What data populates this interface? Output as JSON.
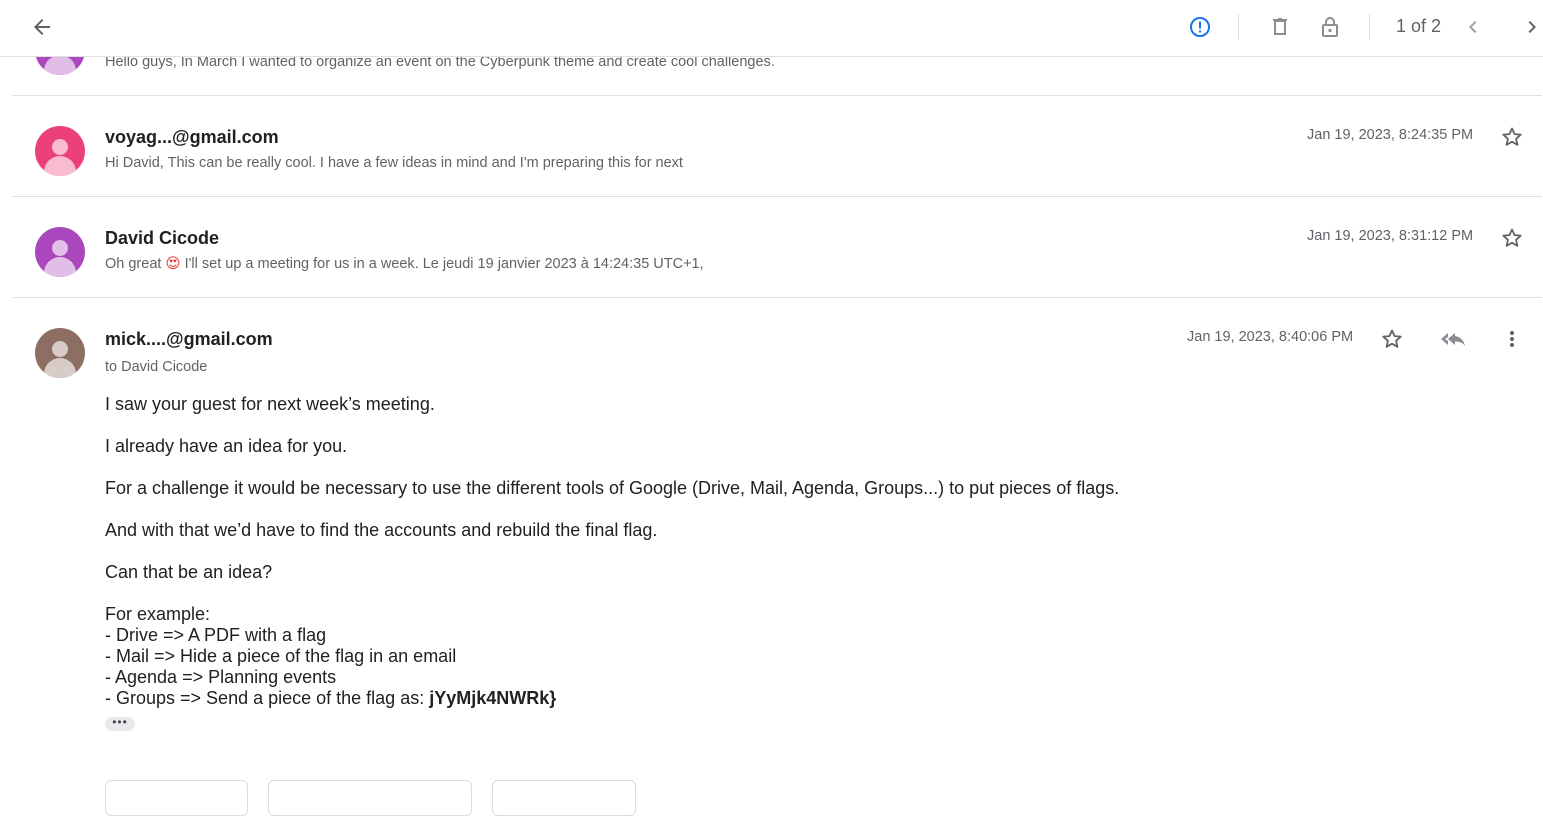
{
  "toolbar": {
    "pager_text": "1 of 2"
  },
  "messages": [
    {
      "snippet": "Hello guys, In March I wanted to organize an event on the Cyberpunk theme and create cool challenges.",
      "avatar_color": "#ab47bc"
    },
    {
      "sender": "voyag...@gmail.com",
      "snippet": "Hi David, This can be really cool. I have a few ideas in mind and I'm preparing this for next",
      "date": "Jan 19, 2023, 8:24:35 PM",
      "avatar_color": "#ec407a"
    },
    {
      "sender": "David Cicode",
      "snippet_pre": "Oh great",
      "snippet_emoji": "😍",
      "snippet_post": "I'll set up a meeting for us in a week. Le jeudi 19 janvier 2023 à 14:24:35 UTC+1,",
      "date": "Jan 19, 2023, 8:31:12 PM",
      "avatar_color": "#ab47bc"
    },
    {
      "sender": "mick....@gmail.com",
      "recipient": "to David Cicode",
      "date": "Jan 19, 2023, 8:40:06 PM",
      "avatar_color": "#8d6e63",
      "body": {
        "p1": "I saw your guest for next week’s meeting.",
        "p2": "I already have an idea for you.",
        "p3": "For a challenge it would be necessary to use the different tools of Google (Drive, Mail, Agenda, Groups...) to put pieces of flags.",
        "p4": "And with that we’d have to find the accounts and rebuild the final flag.",
        "p5": "Can that be an idea?",
        "example_title": "For example:",
        "example_1": "- Drive => A PDF with a flag",
        "example_2": "- Mail => Hide a piece of the flag in an email",
        "example_3": "- Agenda => Planning events",
        "example_4_pre": "- Groups => Send a piece of the flag as: ",
        "flag_piece": "jYyMjk4NWRk}"
      },
      "ellipsis": "•••"
    }
  ],
  "colors": {
    "accent": "#1a73e8",
    "text_secondary": "#5f6368",
    "divider": "#e0e0e0"
  }
}
